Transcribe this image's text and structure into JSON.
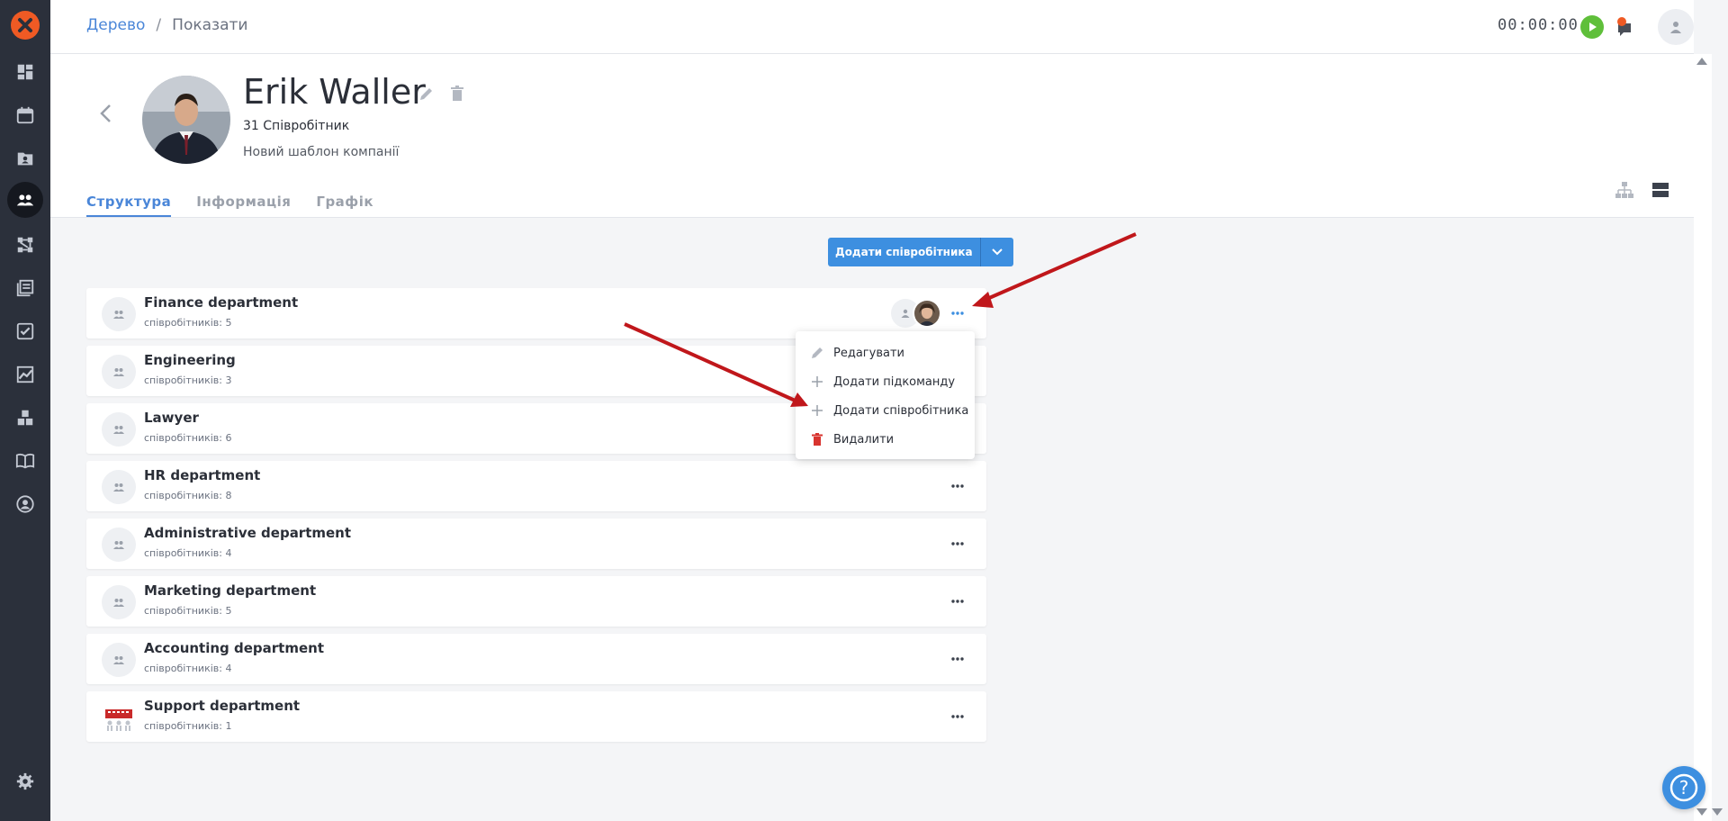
{
  "breadcrumb": {
    "root": "Дерево",
    "separator": "/",
    "current": "Показати"
  },
  "header": {
    "timer": "00:00:00"
  },
  "profile": {
    "name": "Erik Waller",
    "employee_count": "31 Співробітник",
    "template": "Новий шаблон компанії"
  },
  "tabs": [
    {
      "label": "Структура",
      "active": true
    },
    {
      "label": "Інформація",
      "active": false
    },
    {
      "label": "Графік",
      "active": false
    }
  ],
  "toolbar": {
    "add_employee_label": "Додати співробітника"
  },
  "departments": [
    {
      "name": "Finance department",
      "count": "співробітників: 5"
    },
    {
      "name": "Engineering",
      "count": "співробітників: 3"
    },
    {
      "name": "Lawyer",
      "count": "співробітників: 6"
    },
    {
      "name": "HR department",
      "count": "співробітників: 8"
    },
    {
      "name": "Administrative department",
      "count": "співробітників: 4"
    },
    {
      "name": "Marketing department",
      "count": "співробітників: 5"
    },
    {
      "name": "Accounting department",
      "count": "співробітників: 4"
    },
    {
      "name": "Support department",
      "count": "співробітників: 1"
    }
  ],
  "menu": [
    {
      "label": "Редагувати",
      "icon": "pencil-icon"
    },
    {
      "label": "Додати підкоманду",
      "icon": "plus-icon"
    },
    {
      "label": "Додати співробітника",
      "icon": "plus-icon"
    },
    {
      "label": "Видалити",
      "icon": "trash-icon"
    }
  ],
  "colors": {
    "accent": "#4a86d8",
    "button": "#3d8fe0",
    "sidebar": "#2b303b",
    "logo": "#ef5a24",
    "play": "#5fbf3a",
    "delete": "#d8342f",
    "arrow": "#c0171b"
  },
  "icons": {
    "help": "?"
  }
}
